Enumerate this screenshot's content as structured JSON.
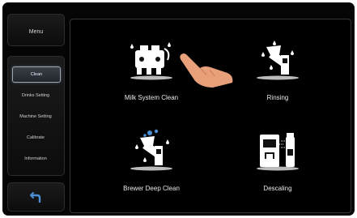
{
  "sidebar": {
    "menu_label": "Menu",
    "items": [
      {
        "label": "Clean",
        "active": true
      },
      {
        "label": "Drinks Setting",
        "active": false
      },
      {
        "label": "Machine Setting",
        "active": false
      },
      {
        "label": "Calibrate",
        "active": false
      },
      {
        "label": "Information",
        "active": false
      }
    ],
    "back_icon": "back-arrow-icon"
  },
  "main": {
    "tiles": [
      {
        "label": "Milk System Clean",
        "icon": "milk-system-clean-icon"
      },
      {
        "label": "Rinsing",
        "icon": "rinsing-icon"
      },
      {
        "label": "Brewer Deep Clean",
        "icon": "brewer-deep-clean-icon"
      },
      {
        "label": "Descaling",
        "icon": "descaling-icon"
      }
    ],
    "pointer_icon": "hand-pointer-icon"
  },
  "colors": {
    "accent": "#4a8fd6",
    "background": "#050505",
    "active_border": "#9aa7b3"
  }
}
